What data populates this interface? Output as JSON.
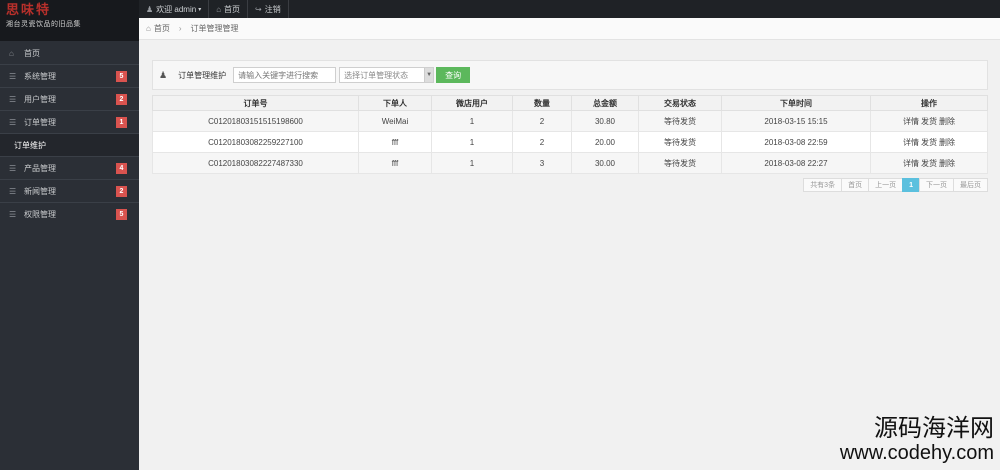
{
  "logo": {
    "title": "思味特",
    "subtitle": "湘台灵瓷饮品的旧品集"
  },
  "topbar": {
    "welcome": "欢迎 admin",
    "home": "首页",
    "logout": "注销"
  },
  "breadcrumb": {
    "home": "首页",
    "current": "订单管理管理"
  },
  "sidebar": {
    "home": "首页",
    "items": [
      {
        "label": "系统管理",
        "badge": "5"
      },
      {
        "label": "用户管理",
        "badge": "2"
      },
      {
        "label": "订单管理",
        "badge": "1"
      }
    ],
    "sub_item": "订单维护",
    "items2": [
      {
        "label": "产品管理",
        "badge": "4"
      },
      {
        "label": "新闻管理",
        "badge": "2"
      },
      {
        "label": "权限管理",
        "badge": "5"
      }
    ]
  },
  "toolbar": {
    "label": "订单管理维护",
    "search_placeholder": "请输入关键字进行搜索",
    "status_placeholder": "选择订单管理状态",
    "query_button": "查询"
  },
  "table": {
    "headers": [
      "订单号",
      "下单人",
      "微店用户",
      "数量",
      "总金额",
      "交易状态",
      "下单时间",
      "操作"
    ],
    "rows": [
      [
        "C01201803151515198600",
        "WeiMai",
        "1",
        "2",
        "30.80",
        "等待发货",
        "2018-03-15 15:15"
      ],
      [
        "C01201803082259227100",
        "fff",
        "1",
        "2",
        "20.00",
        "等待发货",
        "2018-03-08 22:59"
      ],
      [
        "C01201803082227487330",
        "fff",
        "1",
        "3",
        "30.00",
        "等待发货",
        "2018-03-08 22:27"
      ]
    ],
    "ops": [
      "详情",
      "发货",
      "删除"
    ]
  },
  "pager": {
    "total": "共有3条",
    "first": "首页",
    "prev": "上一页",
    "current": "1",
    "next": "下一页",
    "last": "最后页"
  },
  "watermark": {
    "cn": "源码海洋网",
    "url": "www.codehy.com"
  }
}
